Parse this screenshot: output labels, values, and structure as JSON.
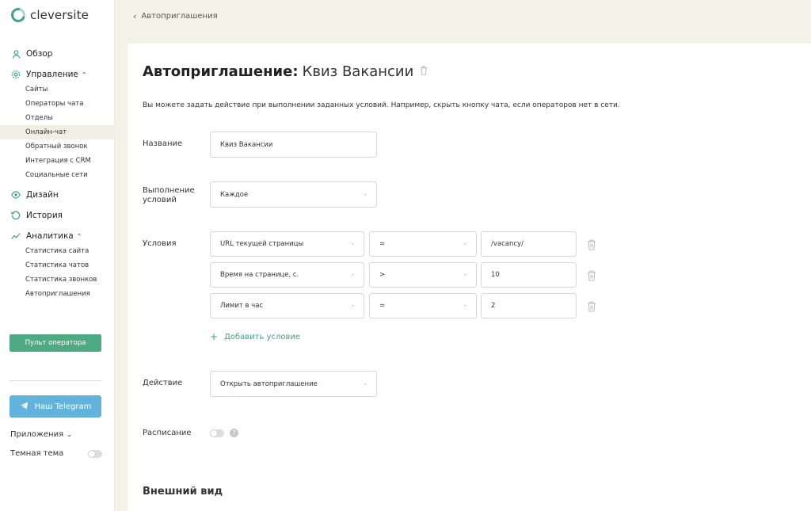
{
  "brand": {
    "name": "cleversite",
    "accent": "#3da37e"
  },
  "sidebar": {
    "nav": [
      {
        "label": "Обзор",
        "icon": "user-icon"
      },
      {
        "label": "Управление",
        "icon": "gear-icon",
        "expanded": true,
        "children": [
          "Сайты",
          "Операторы чата",
          "Отделы",
          "Онлайн-чат",
          "Обратный звонок",
          "Интеграция с CRM",
          "Социальные сети"
        ]
      },
      {
        "label": "Дизайн",
        "icon": "eye-icon"
      },
      {
        "label": "История",
        "icon": "history-icon"
      },
      {
        "label": "Аналитика",
        "icon": "chart-line-icon",
        "expanded": true,
        "children": [
          "Статистика сайта",
          "Статистика чатов",
          "Статистика звонков",
          "Автоприглашения"
        ]
      }
    ],
    "active_item": "Онлайн-чат",
    "operator_button": "Пульт оператора",
    "telegram_button": "Наш Telegram",
    "apps_label": "Приложения",
    "dark_theme_label": "Темная тема"
  },
  "breadcrumb": {
    "back_label": "Автоприглашения"
  },
  "form": {
    "title_prefix": "Автоприглашение:",
    "title_name": "Квиз Вакансии",
    "description": "Вы можете задать действие при выполнении заданных условий. Например, скрыть кнопку чата, если операторов нет в сети.",
    "name_label": "Название",
    "name_value": "Квиз Вакансии",
    "execution_label_line1": "Выполнение",
    "execution_label_line2": "условий",
    "execution_value": "Каждое",
    "conditions_label": "Условия",
    "conditions": [
      {
        "field": "URL текущей страницы",
        "operator": "=",
        "value": "/vacancy/"
      },
      {
        "field": "Время на странице, с.",
        "operator": ">",
        "value": "10"
      },
      {
        "field": "Лимит в час",
        "operator": "=",
        "value": "2"
      }
    ],
    "add_condition_label": "Добавить условие",
    "action_label": "Действие",
    "action_value": "Открыть автоприглашение",
    "schedule_label": "Расписание",
    "schedule_enabled": false,
    "appearance_section": "Внешний вид"
  }
}
